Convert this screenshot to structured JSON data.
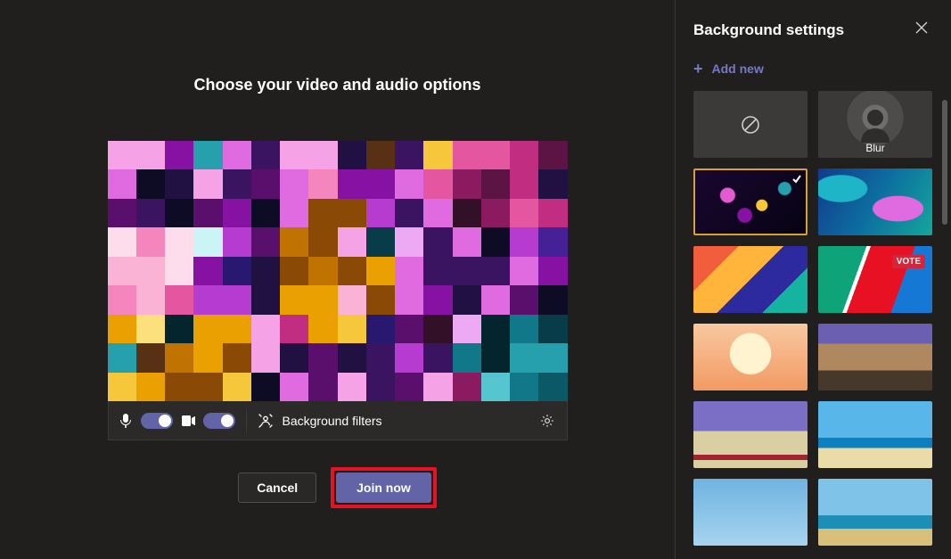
{
  "main": {
    "title": "Choose your video and audio options",
    "controls": {
      "mic_on": true,
      "camera_on": true,
      "bg_filters_label": "Background filters"
    },
    "buttons": {
      "cancel": "Cancel",
      "join": "Join now"
    }
  },
  "side": {
    "title": "Background settings",
    "add_new": "Add new",
    "tiles": [
      {
        "id": "none",
        "type": "none",
        "label": ""
      },
      {
        "id": "blur",
        "type": "blur",
        "label": "Blur"
      },
      {
        "id": "bokeh",
        "type": "image",
        "label": "",
        "selected": true
      },
      {
        "id": "waves",
        "type": "image"
      },
      {
        "id": "hands",
        "type": "image"
      },
      {
        "id": "vote",
        "type": "image"
      },
      {
        "id": "cake",
        "type": "image"
      },
      {
        "id": "room",
        "type": "image"
      },
      {
        "id": "shelf",
        "type": "image"
      },
      {
        "id": "beach",
        "type": "image"
      },
      {
        "id": "sky",
        "type": "image"
      },
      {
        "id": "resort",
        "type": "image"
      }
    ]
  },
  "colors": {
    "accent": "#6264a7",
    "highlight": "#e81123",
    "selected": "#d8a03a"
  }
}
